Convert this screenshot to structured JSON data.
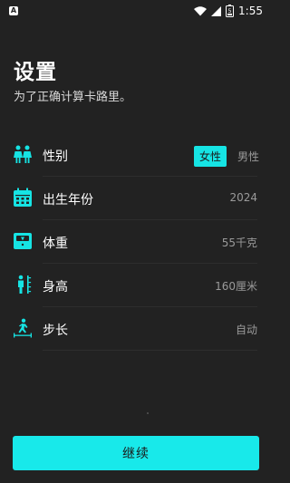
{
  "status_bar": {
    "notification_icon": "text-notification-icon",
    "notification_glyph": "A",
    "time": "1:55",
    "battery_level": "5",
    "icons": [
      "wifi-icon",
      "signal-icon",
      "battery-icon"
    ]
  },
  "header": {
    "title": "设置",
    "subtitle": "为了正确计算卡路里。"
  },
  "rows": [
    {
      "icon": "gender-icon",
      "label": "性别",
      "options": [
        "女性",
        "男性"
      ],
      "selected": "女性"
    },
    {
      "icon": "calendar-icon",
      "label": "出生年份",
      "value": "2024"
    },
    {
      "icon": "scale-icon",
      "label": "体重",
      "value": "55千克"
    },
    {
      "icon": "height-icon",
      "label": "身高",
      "value": "160厘米"
    },
    {
      "icon": "stride-icon",
      "label": "步长",
      "value": "自动"
    }
  ],
  "continue_button": {
    "label": "继续"
  },
  "colors": {
    "accent": "#18e9ea",
    "background": "#222222",
    "muted_text": "#9a9a9a"
  }
}
